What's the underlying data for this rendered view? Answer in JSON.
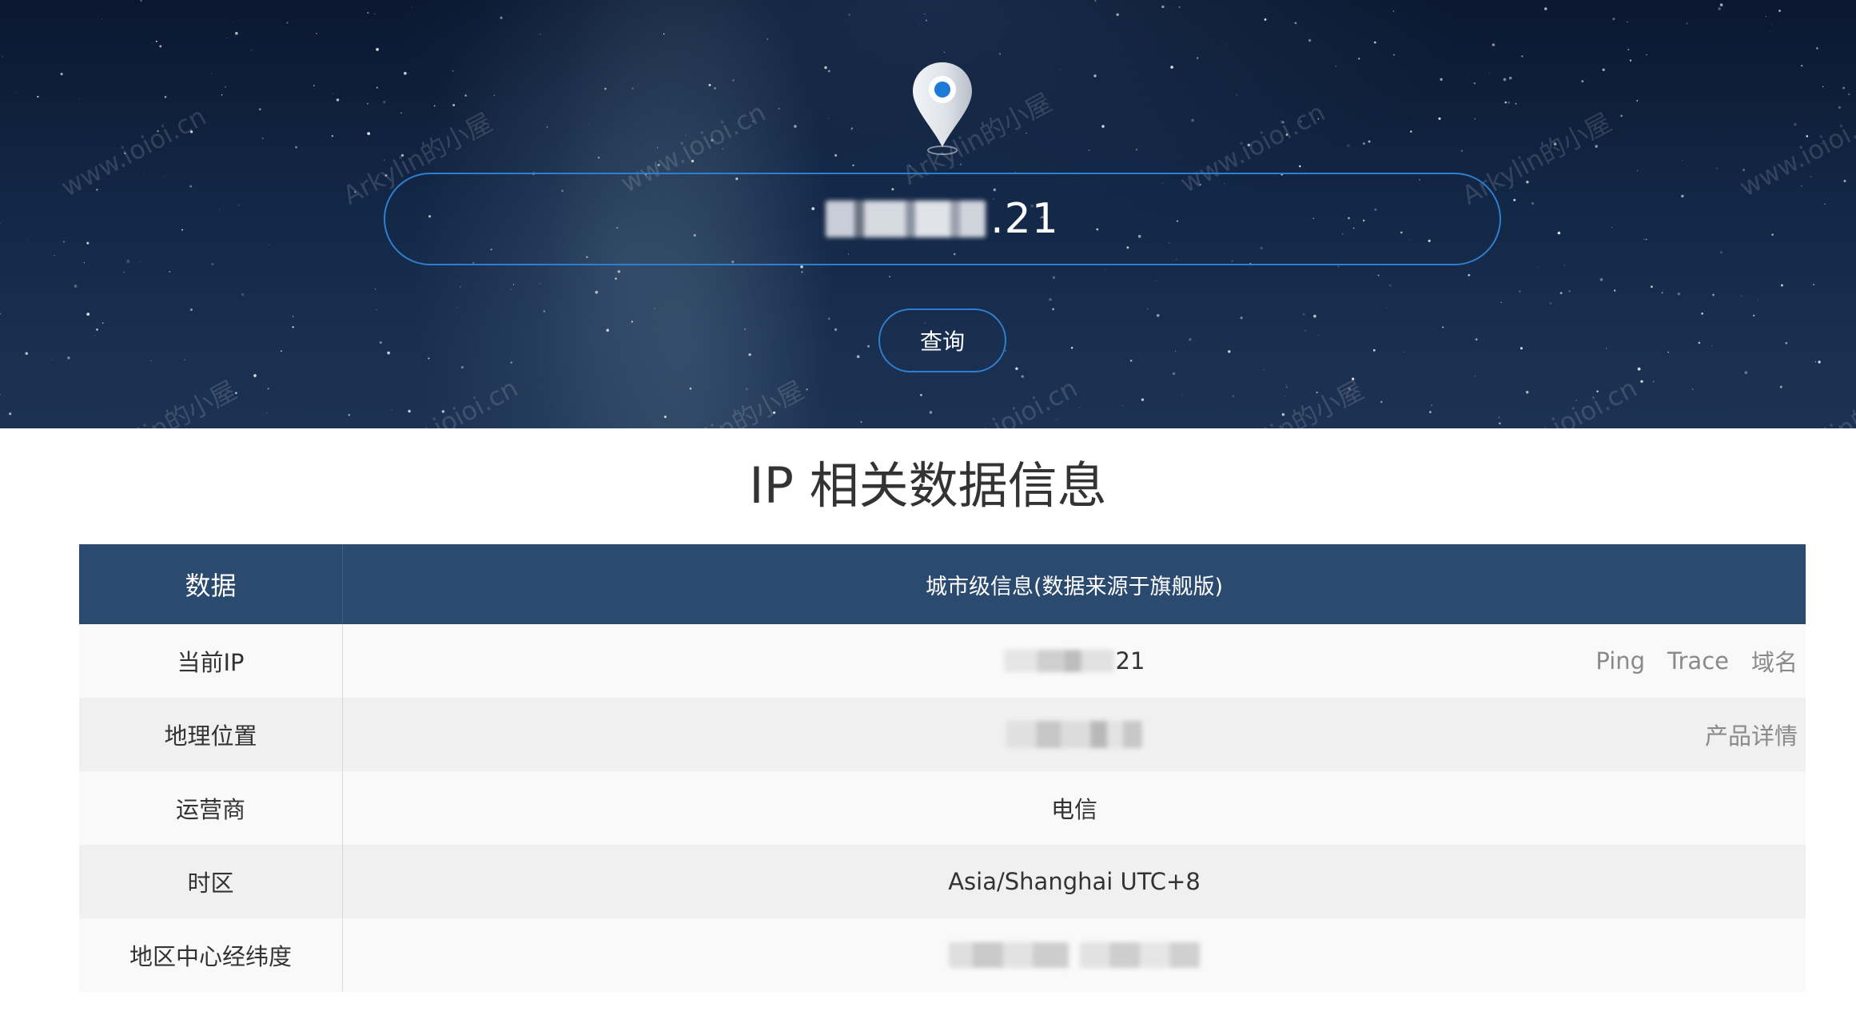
{
  "hero": {
    "ip_suffix": ".21",
    "query_button_label": "查询",
    "watermarks": [
      "www.ioioi.cn",
      "Arkylin的小屋"
    ]
  },
  "section": {
    "title": "IP 相关数据信息"
  },
  "table": {
    "headers": {
      "key": "数据",
      "value": "城市级信息(数据来源于旗舰版)"
    },
    "rows": [
      {
        "label": "当前IP",
        "value_suffix": "21",
        "actions": [
          "Ping",
          "Trace",
          "域名"
        ]
      },
      {
        "label": "地理位置",
        "actions": [
          "产品详情"
        ]
      },
      {
        "label": "运营商",
        "value": "电信"
      },
      {
        "label": "时区",
        "value": "Asia/Shanghai UTC+8"
      },
      {
        "label": "地区中心经纬度"
      }
    ]
  },
  "colors": {
    "header_bg": "#2b4a6f",
    "accent_border": "#2e7fd0",
    "row_odd": "#f9f9f9",
    "row_even": "#f0f0f0"
  },
  "icons": {
    "location_pin": "map-pin-icon"
  }
}
